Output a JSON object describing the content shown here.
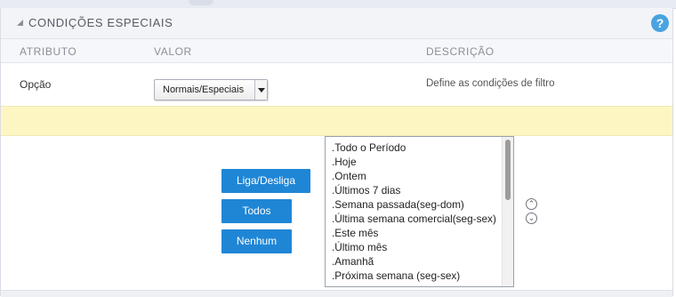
{
  "section": {
    "title": "CONDIÇÕES ESPECIAIS",
    "help_label": "?"
  },
  "columns": {
    "attribute": "ATRIBUTO",
    "value": "VALOR",
    "description": "DESCRIÇÃO"
  },
  "option_row": {
    "label": "Opção",
    "select_value": "Normais/Especiais",
    "description": "Define as condições de filtro"
  },
  "buttons": {
    "toggle": "Liga/Desliga",
    "all": "Todos",
    "none": "Nenhum"
  },
  "periods": [
    ".Todo o Período",
    ".Hoje",
    ".Ontem",
    ".Últimos 7 dias",
    ".Semana passada(seg-dom)",
    ".Última semana comercial(seg-sex)",
    ".Este mês",
    ".Último mês",
    ".Amanhã",
    ".Próxima semana (seg-sex)"
  ],
  "icons": {
    "collapse": "triangle-collapse-icon",
    "help": "help-icon",
    "move_up": "chevron-up-circle-icon",
    "move_down": "chevron-down-circle-icon"
  },
  "colors": {
    "accent_button": "#1f86d6",
    "help_icon": "#4aa3e0",
    "highlight_band": "#fdf6c3"
  }
}
